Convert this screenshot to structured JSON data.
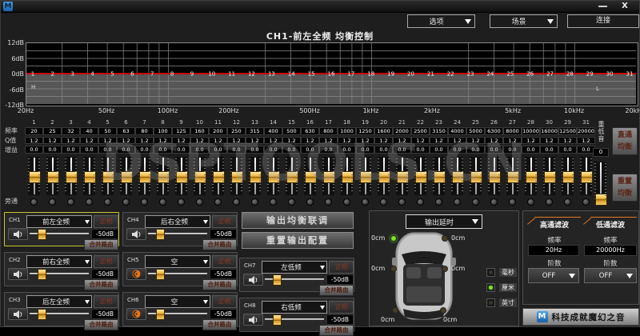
{
  "window": {
    "logo": "M",
    "close": "X"
  },
  "toolbar": {
    "options": "选项",
    "scene": "场景",
    "connect": "连接"
  },
  "page_title": "CH1-前左全频 均衡控制",
  "watermark": "DSPTOOLS.CN",
  "eq_graph": {
    "y_labels": [
      "12dB",
      "6dB",
      "0dB",
      "-6dB",
      "-12dB"
    ],
    "x_labels": [
      {
        "text": "20Hz",
        "f": 20
      },
      {
        "text": "50Hz",
        "f": 50
      },
      {
        "text": "100Hz",
        "f": 100
      },
      {
        "text": "200Hz",
        "f": 200
      },
      {
        "text": "500Hz",
        "f": 500
      },
      {
        "text": "1kHz",
        "f": 1000
      },
      {
        "text": "2kHz",
        "f": 2000
      },
      {
        "text": "5kHz",
        "f": 5000
      },
      {
        "text": "10kHz",
        "f": 10000
      },
      {
        "text": "20kHz",
        "f": 20000
      }
    ],
    "band_count": 31,
    "hp_marker": "H",
    "lp_marker": "L",
    "line_color": "#c40000",
    "ylim": [
      -12,
      12
    ]
  },
  "bands": {
    "labels": {
      "freq": "频率",
      "q": "Q值",
      "gain": "增益",
      "bypass": "旁通"
    },
    "numbers": [
      "1",
      "2",
      "3",
      "4",
      "5",
      "6",
      "7",
      "8",
      "9",
      "10",
      "11",
      "12",
      "13",
      "14",
      "15",
      "16",
      "17",
      "18",
      "19",
      "20",
      "21",
      "22",
      "23",
      "24",
      "25",
      "26",
      "27",
      "28",
      "30",
      "29",
      "31"
    ],
    "frequencies": [
      "20",
      "25",
      "32",
      "40",
      "50",
      "63",
      "80",
      "100",
      "125",
      "160",
      "200",
      "250",
      "315",
      "400",
      "500",
      "630",
      "800",
      "1000",
      "1250",
      "1600",
      "2000",
      "2500",
      "3150",
      "4000",
      "5000",
      "6300",
      "8000",
      "10000",
      "16000",
      "12500",
      "20000"
    ],
    "q_values": [
      "1.2",
      "1.2",
      "1.2",
      "1.2",
      "1.2",
      "1.2",
      "1.2",
      "1.2",
      "1.2",
      "1.2",
      "1.2",
      "1.2",
      "1.2",
      "1.2",
      "1.2",
      "1.2",
      "1.2",
      "1.2",
      "1.2",
      "1.2",
      "1.2",
      "1.2",
      "1.2",
      "1.2",
      "1.2",
      "1.2",
      "1.2",
      "1.2",
      "1.2",
      "1.2",
      "1.2"
    ],
    "gains": [
      "0.0",
      "0.0",
      "0.0",
      "0.0",
      "0.0",
      "0.0",
      "0.0",
      "0.0",
      "0.0",
      "0.0",
      "0.0",
      "0.0",
      "0.0",
      "0.0",
      "0.0",
      "0.0",
      "0.0",
      "0.0",
      "0.0",
      "0.0",
      "0.0",
      "0.0",
      "0.0",
      "0.0",
      "0.0",
      "0.0",
      "0.0",
      "0.0",
      "0.0",
      "0.0",
      "0.0"
    ]
  },
  "subwoofer": {
    "label": "重低音",
    "value": "0"
  },
  "side_buttons": {
    "direct_eq": "直通\n均衡",
    "reset_eq": "重置\n均衡"
  },
  "channels": [
    {
      "id": "CH1",
      "name": "前左全频",
      "selected": true,
      "muted": false
    },
    {
      "id": "CH2",
      "name": "前右全频",
      "selected": false,
      "muted": false
    },
    {
      "id": "CH3",
      "name": "后左全频",
      "selected": false,
      "muted": false
    },
    {
      "id": "CH4",
      "name": "后右全频",
      "selected": false,
      "muted": false
    },
    {
      "id": "CH5",
      "name": "空",
      "selected": false,
      "muted": true
    },
    {
      "id": "CH6",
      "name": "空",
      "selected": false,
      "muted": true
    },
    {
      "id": "CH7",
      "name": "左低频",
      "selected": false,
      "muted": false
    },
    {
      "id": "CH8",
      "name": "右低频",
      "selected": false,
      "muted": false
    }
  ],
  "channel_common": {
    "phase": "正相",
    "gain": "-50dB",
    "merge": "合并路由"
  },
  "output_buttons": {
    "link": "输出均衡联调",
    "reset": "重置输出配置"
  },
  "delay": {
    "title": "输出延时",
    "values": {
      "front_left": "0cm",
      "front_right": "0cm",
      "mid_left": "0cm",
      "mid_right": "0cm",
      "rear_left": "0cm",
      "rear_right": "0cm"
    },
    "active_position": "front_left",
    "units": [
      {
        "label": "毫秒",
        "selected": false
      },
      {
        "label": "厘米",
        "selected": true
      },
      {
        "label": "英寸",
        "selected": false
      }
    ]
  },
  "filters": {
    "hp": {
      "title": "高通滤波",
      "freq_label": "频率",
      "freq": "20Hz",
      "order_label": "阶数",
      "order": "OFF"
    },
    "lp": {
      "title": "低通滤波",
      "freq_label": "频率",
      "freq": "20000Hz",
      "order_label": "阶数",
      "order": "OFF"
    }
  },
  "brand": {
    "logo": "M",
    "slogan": "科技成就魔幻之音"
  },
  "colors": {
    "accent_red": "#c40000",
    "gold": "#f0b43c",
    "green": "#7ce22a",
    "orange": "#e07820",
    "select_yellow": "#c8c432",
    "logo_blue": "#1b5fa8"
  }
}
